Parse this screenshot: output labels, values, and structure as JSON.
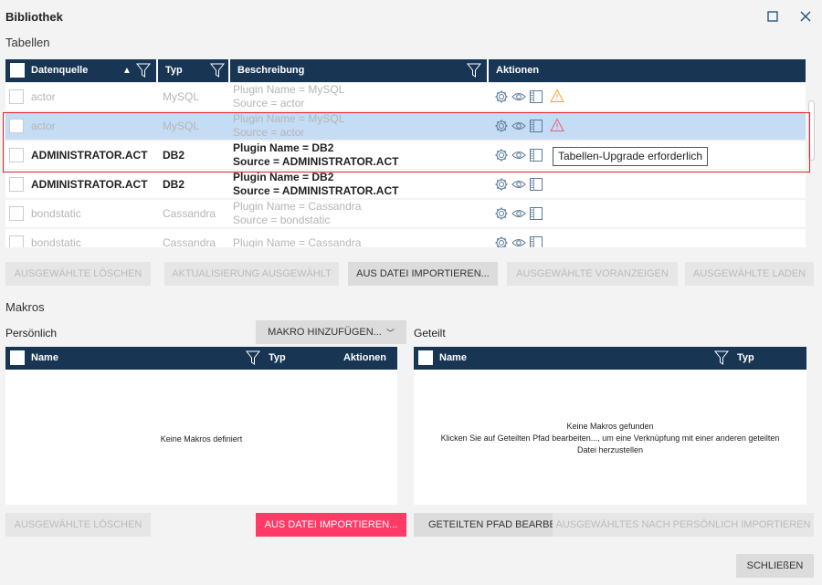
{
  "window": {
    "title": "Bibliothek",
    "maximize_icon": "maximize-icon",
    "close_icon": "close-icon"
  },
  "tables": {
    "section_title": "Tabellen",
    "columns": [
      "Datenquelle",
      "Typ",
      "Beschreibung",
      "Aktionen"
    ],
    "rows": [
      {
        "name": "actor",
        "type": "MySQL",
        "desc1": "Plugin Name = MySQL",
        "desc2": "Source = actor",
        "state": "disabled",
        "warning": "orange"
      },
      {
        "name": "actor",
        "type": "MySQL",
        "desc1": "Plugin Name = MySQL",
        "desc2": "Source = actor",
        "state": "selected",
        "warning": "red"
      },
      {
        "name": "ADMINISTRATOR.ACT",
        "type": "DB2",
        "desc1": "Plugin Name = DB2",
        "desc2": "Source = ADMINISTRATOR.ACT",
        "state": "enabled",
        "warning": ""
      },
      {
        "name": "ADMINISTRATOR.ACT",
        "type": "DB2",
        "desc1": "Plugin Name = DB2",
        "desc2": "Source = ADMINISTRATOR.ACT",
        "state": "enabled",
        "warning": ""
      },
      {
        "name": "bondstatic",
        "type": "Cassandra",
        "desc1": "Plugin Name = Cassandra",
        "desc2": "Source = bondstatic",
        "state": "disabled",
        "warning": ""
      },
      {
        "name": "bondstatic",
        "type": "Cassandra",
        "desc1": "Plugin Name = Cassandra",
        "desc2": "",
        "state": "disabled",
        "warning": ""
      }
    ],
    "tooltip": "Tabellen-Upgrade erforderlich",
    "buttons": [
      "AUSGEWÄHLTE LÖSCHEN",
      "AKTUALISIERUNG AUSGEWÄHLT",
      "AUS DATEI IMPORTIEREN...",
      "AUSGEWÄHLTE VORANZEIGEN",
      "AUSGEWÄHLTE LADEN"
    ]
  },
  "macros": {
    "section_title": "Makros",
    "personal": {
      "label": "Persönlich",
      "add_button": "MAKRO HINZUFÜGEN...",
      "columns": [
        "Name",
        "Typ",
        "Aktionen"
      ],
      "empty": "Keine Makros definiert",
      "buttons": [
        "AUSGEWÄHLTE LÖSCHEN",
        "AUS DATEI IMPORTIEREN..."
      ]
    },
    "shared": {
      "label": "Geteilt",
      "columns": [
        "Name",
        "Typ"
      ],
      "empty1": "Keine Makros gefunden",
      "empty2": "Klicken Sie auf Geteilten Pfad bearbeiten..., um eine Verknüpfung mit einer anderen geteilten",
      "empty3": "Datei herzustellen",
      "buttons": [
        "GETEILTEN PFAD BEARBEITEN...",
        "AUSGEWÄHLTES NACH PERSÖNLICH IMPORTIEREN"
      ]
    }
  },
  "footer": {
    "close_button": "SCHLIEßEN"
  },
  "colors": {
    "header": "#183654",
    "accent": "#ff3a66",
    "selected": "#c5dcf5",
    "highlight": "#e0202a"
  }
}
